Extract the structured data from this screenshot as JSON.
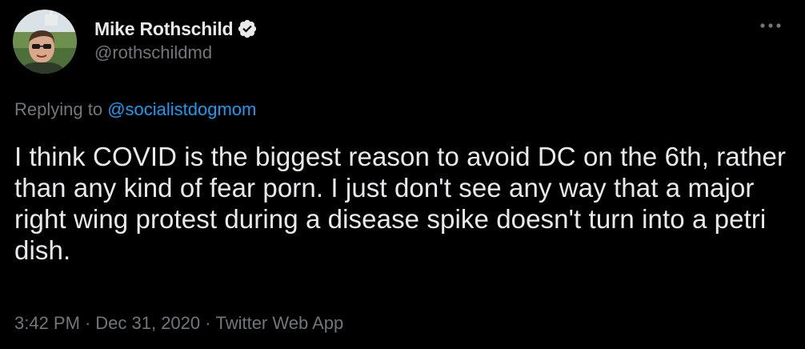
{
  "author": {
    "display_name": "Mike Rothschild",
    "handle": "@rothschildmd",
    "verified": true
  },
  "reply": {
    "prefix": "Replying to ",
    "mention": "@socialistdogmom"
  },
  "tweet": {
    "text": "I think COVID is the biggest reason to avoid DC on the 6th, rather than any kind of fear porn. I just don't see any way that a major right wing protest during a disease spike doesn't turn into a petri dish."
  },
  "meta": {
    "time": "3:42 PM",
    "separator": "·",
    "date": "Dec 31, 2020",
    "source": "Twitter Web App"
  },
  "icons": {
    "more": "more-horizontal-icon",
    "verified": "verified-badge-icon"
  },
  "colors": {
    "background": "#000000",
    "text": "#e7e9ea",
    "muted": "#71767b",
    "link": "#1d9bf0"
  }
}
